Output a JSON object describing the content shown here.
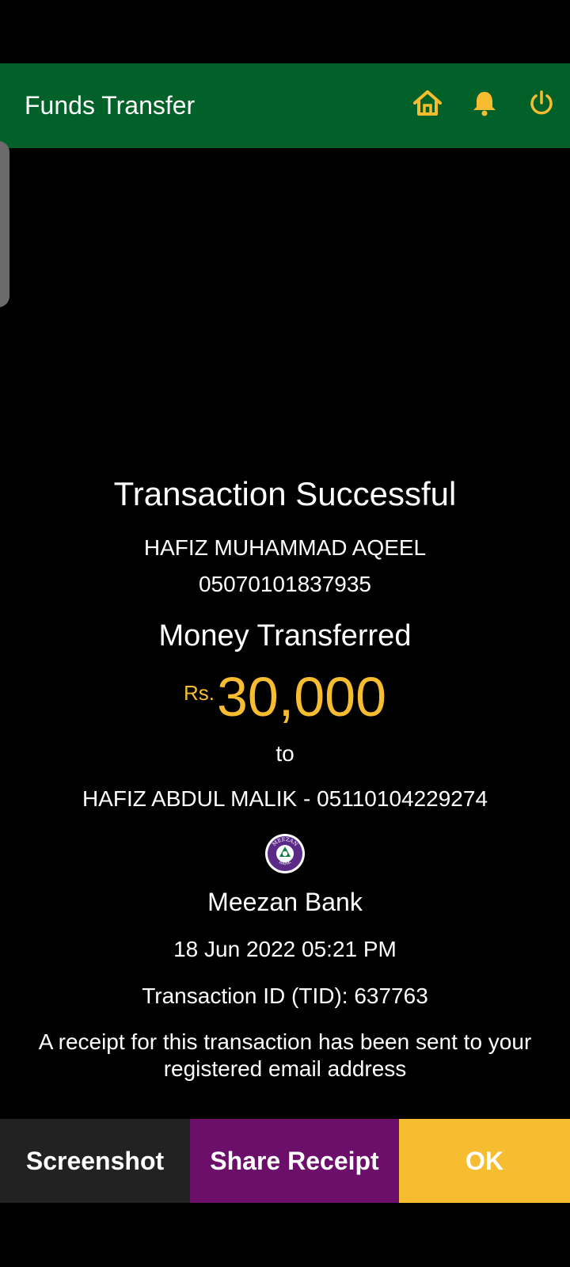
{
  "header": {
    "title": "Funds Transfer",
    "icons": [
      "home-icon",
      "bell-icon",
      "power-icon"
    ],
    "background": "#026128",
    "icon_color": "#f6bd30"
  },
  "receipt": {
    "status": "Transaction Successful",
    "sender_name": "HAFIZ MUHAMMAD AQEEL",
    "sender_account": "05070101837935",
    "action_label": "Money Transferred",
    "currency": "Rs.",
    "amount": "30,000",
    "to_word": "to",
    "recipient": "HAFIZ ABDUL MALIK - 05110104229274",
    "bank_logo_top_text": "MEEZAN",
    "bank_logo_bottom_text": "BANK",
    "bank_name": "Meezan Bank",
    "datetime": "18 Jun 2022 05:21 PM",
    "transaction_id": "Transaction ID (TID): 637763",
    "note": "A receipt for this transaction has been sent to your registered email address"
  },
  "actions": {
    "screenshot": "Screenshot",
    "share": "Share Receipt",
    "ok": "OK"
  },
  "colors": {
    "accent": "#f6bd30",
    "share_bg": "#6b0f6b",
    "screenshot_bg": "#222222"
  }
}
